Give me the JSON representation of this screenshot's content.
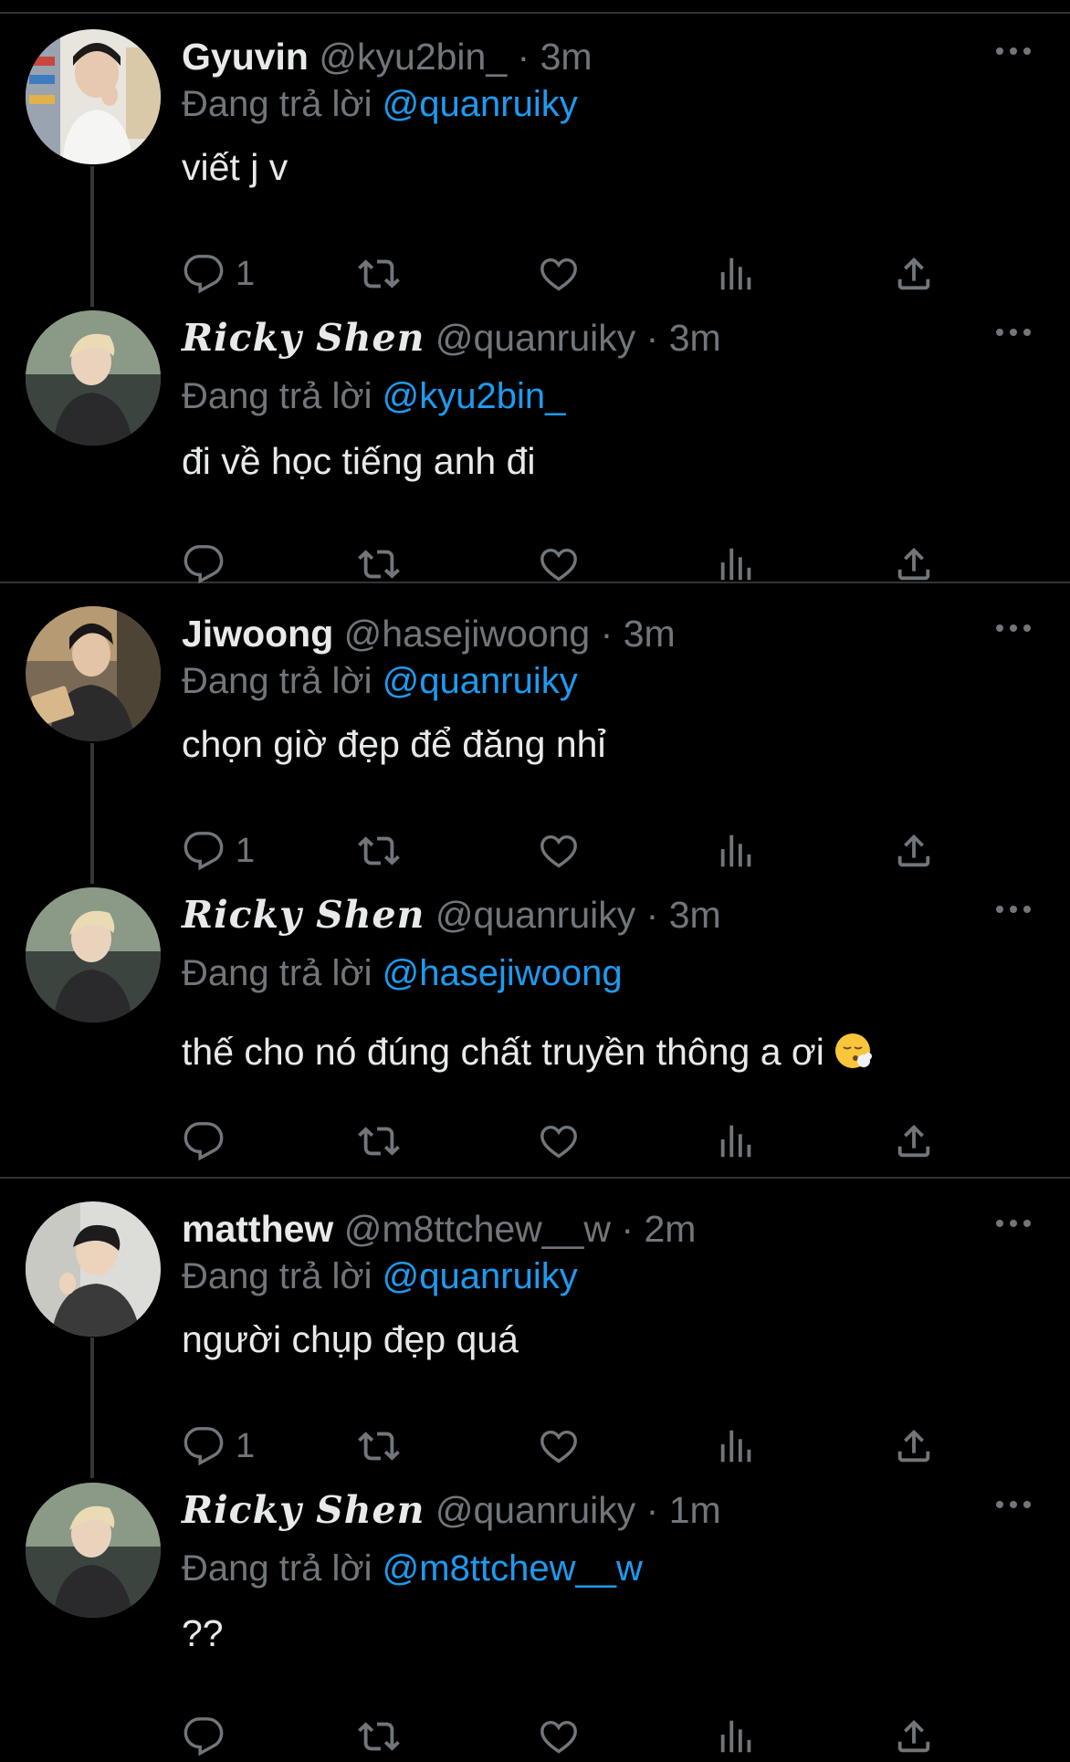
{
  "reply_prefix": "Đang trả lời",
  "tweets": [
    {
      "name": "Gyuvin",
      "handle": "@kyu2bin_",
      "time": "3m",
      "reply_to": "@quanruiky",
      "text": "viết j v",
      "reply_count": "1",
      "avatar": "gyuvin"
    },
    {
      "name": "Ricky Shen",
      "handle": "@quanruiky",
      "time": "3m",
      "reply_to": "@kyu2bin_",
      "text": "đi về học tiếng anh đi",
      "reply_count": "",
      "avatar": "ricky"
    },
    {
      "name": "Jiwoong",
      "handle": "@hasejiwoong",
      "time": "3m",
      "reply_to": "@quanruiky",
      "text": "chọn giờ đẹp để đăng nhỉ",
      "reply_count": "1",
      "avatar": "jiwoong"
    },
    {
      "name": "Ricky Shen",
      "handle": "@quanruiky",
      "time": "3m",
      "reply_to": "@hasejiwoong",
      "text": "thế cho nó đúng chất truyền thông a ơi",
      "emoji": "face-exhaling-emoji",
      "reply_count": "",
      "avatar": "ricky"
    },
    {
      "name": "matthew",
      "handle": "@m8ttchew__w",
      "time": "2m",
      "reply_to": "@quanruiky",
      "text": "người chụp đẹp quá",
      "reply_count": "1",
      "avatar": "matthew"
    },
    {
      "name": "Ricky Shen",
      "handle": "@quanruiky",
      "time": "1m",
      "reply_to": "@m8ttchew__w",
      "text": "??",
      "reply_count": "",
      "avatar": "ricky"
    }
  ],
  "icons": [
    "reply-icon",
    "retweet-icon",
    "like-icon",
    "views-icon",
    "share-icon",
    "more-icon"
  ],
  "colors": {
    "background": "#000000",
    "text": "#e7e9ea",
    "secondary": "#71767b",
    "mention": "#1d9bf0",
    "divider": "#2f3336"
  }
}
